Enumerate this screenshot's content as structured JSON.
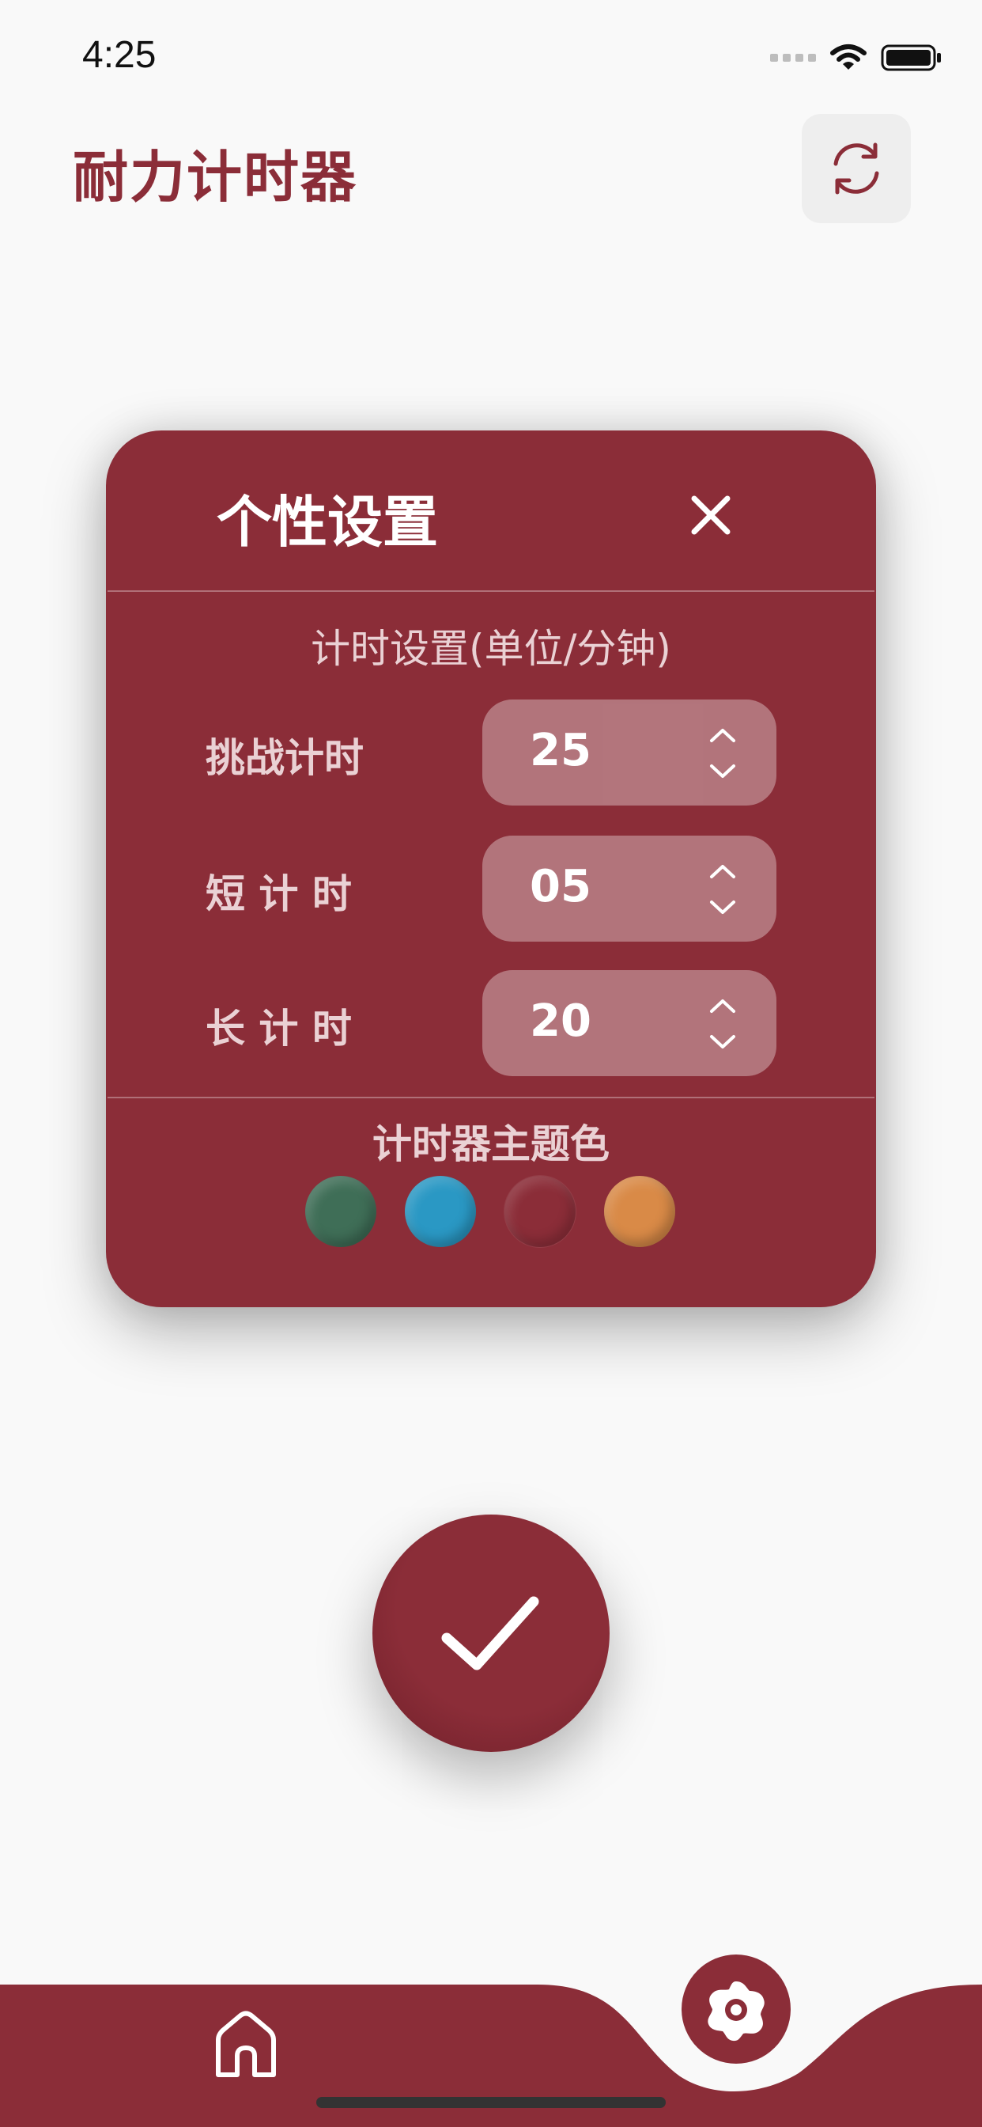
{
  "status_bar": {
    "time": "4:25"
  },
  "header": {
    "title": "耐力计时器",
    "refresh_icon": "refresh-icon"
  },
  "colors": {
    "accent": "#8b2d38",
    "background": "#f9f9f9",
    "themes": [
      "#3f6e57",
      "#2a98c4",
      "#8b2d38",
      "#d98a47"
    ]
  },
  "dialog": {
    "title": "个性设置",
    "section_timer": "计时设置(单位/分钟)",
    "rows": [
      {
        "label": "挑战计时",
        "value": "25"
      },
      {
        "label": "短 计 时",
        "value": "05"
      },
      {
        "label": "长 计 时",
        "value": "20"
      }
    ],
    "section_theme": "计时器主题色"
  },
  "confirm_icon": "checkmark-icon",
  "tabbar": {
    "items": [
      "home-icon",
      "settings-icon"
    ]
  }
}
